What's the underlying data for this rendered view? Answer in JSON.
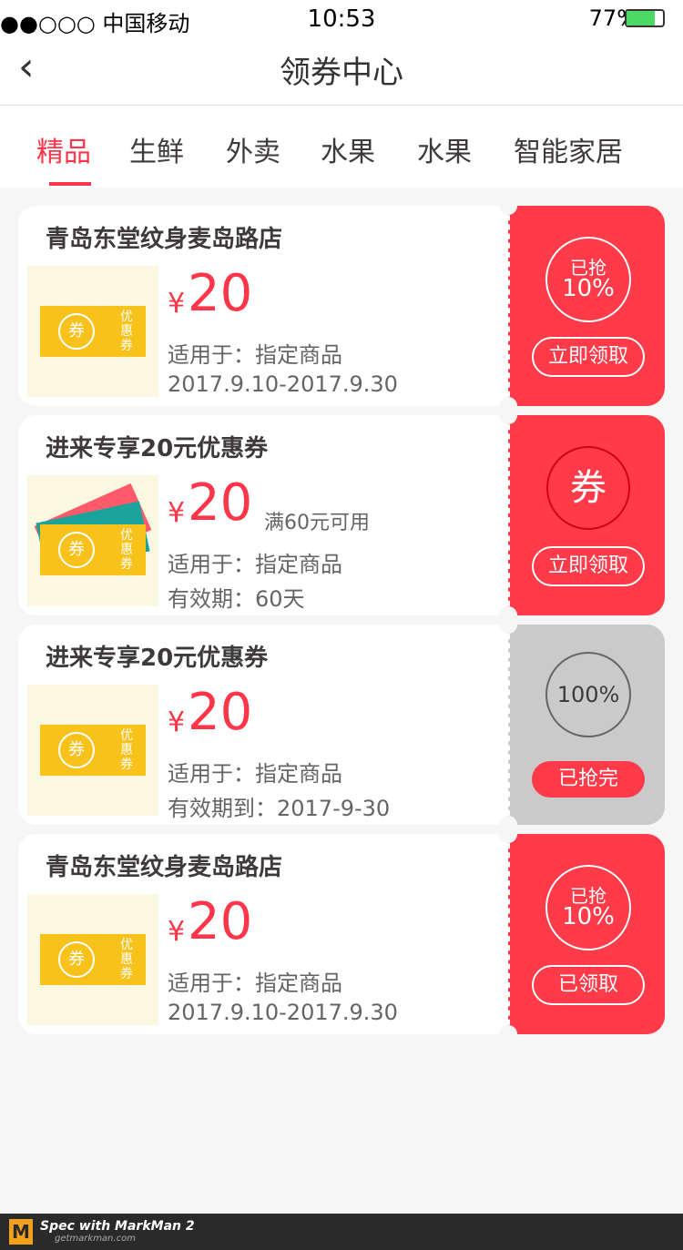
{
  "status_bar": {
    "carrier": "●●○○○ 中国移动",
    "time": "10:53",
    "battery": "77%"
  },
  "nav": {
    "back_icon": "‹",
    "title": "领券中心"
  },
  "tabs": [
    {
      "label": "精品",
      "active": true
    },
    {
      "label": "生鲜",
      "active": false
    },
    {
      "label": "外卖",
      "active": false
    },
    {
      "label": "水果",
      "active": false
    },
    {
      "label": "水果",
      "active": false
    },
    {
      "label": "智能家居",
      "active": false
    }
  ],
  "coupons": [
    {
      "store": "青岛东堂纹身麦岛路店",
      "yen": "¥",
      "amount": "20",
      "condition": "",
      "scope": "适用于：指定商品",
      "validity": "2017.9.10-2017.9.30",
      "status_top": "已抢",
      "status_pct": "10%",
      "action": "立即领取",
      "right_color": "#ff3a49"
    },
    {
      "store": "进来专享20元优惠券",
      "yen": "¥",
      "amount": "20",
      "condition": "满60元可用",
      "scope": "适用于：指定商品",
      "validity": "有效期：60天",
      "badge": "券",
      "action": "立即领取",
      "right_color": "#ff3a49"
    },
    {
      "store": "进来专享20元优惠券",
      "yen": "¥",
      "amount": "20",
      "condition": "",
      "scope": "适用于：指定商品",
      "validity": "有效期到：2017-9-30",
      "status_pct": "100%",
      "action": "已抢完",
      "right_color": "#cacaca"
    },
    {
      "store": "青岛东堂纹身麦岛路店",
      "yen": "¥",
      "amount": "20",
      "condition": "",
      "scope": "适用于：指定商品",
      "validity": "2017.9.10-2017.9.30",
      "status_top": "已抢",
      "status_pct": "10%",
      "action": "已领取",
      "right_color": "#ff3a49"
    }
  ],
  "ticket": {
    "circle": "券",
    "text": "优惠券"
  },
  "colors": {
    "accent": "#ff3649",
    "text": "#3e3a39",
    "sub": "#666464",
    "bg": "#f6f6f6",
    "sold": "#cacaca",
    "btn": "#ff3a49",
    "ring": "#d50011"
  },
  "footer": {
    "brand": "Spec with MarkMan 2",
    "site": "getmarkman.com"
  }
}
